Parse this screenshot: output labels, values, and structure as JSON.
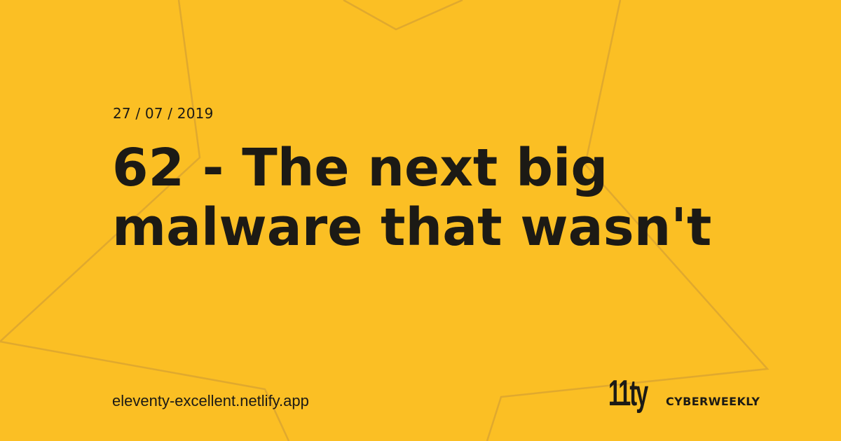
{
  "card": {
    "date": "27 / 07 / 2019",
    "title": "62 - The next big malware that wasn't",
    "url": "eleventy-excellent.netlify.app",
    "logo_text": "11ty",
    "brand_name": "CYBERWEEKLY"
  },
  "colors": {
    "background": "#FBBF24",
    "text": "#1c1a15",
    "decoration_stroke": "#E3AB2A"
  },
  "icons": {
    "background_shape": "star-outline-icon",
    "logo": "eleventy-logo"
  }
}
